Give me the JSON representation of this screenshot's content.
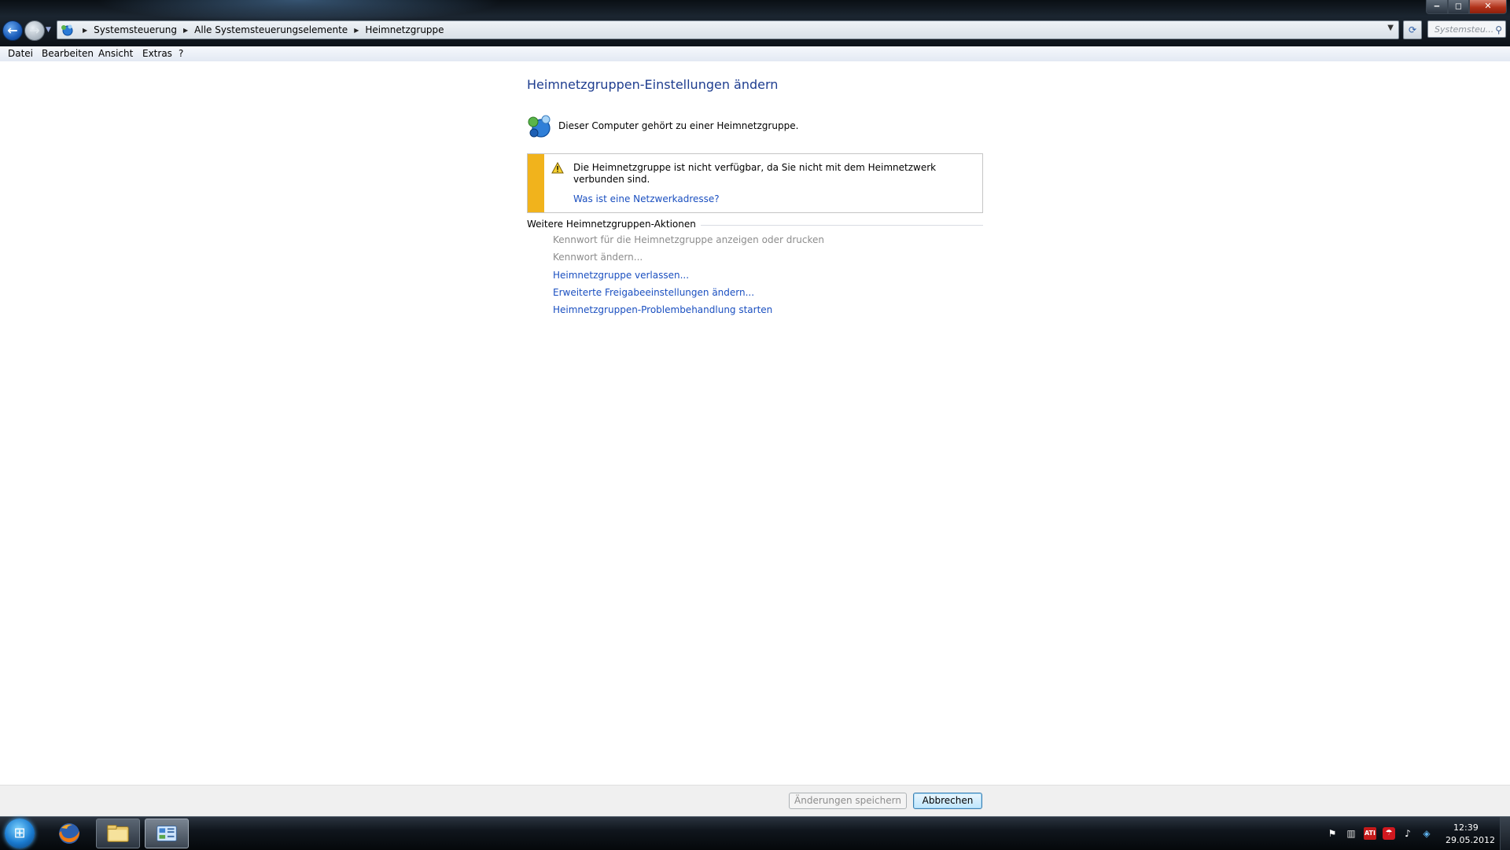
{
  "window": {
    "breadcrumb": [
      "Systemsteuerung",
      "Alle Systemsteuerungselemente",
      "Heimnetzgruppe"
    ],
    "search_placeholder": "Systemsteu...",
    "caption": {
      "minimize": "‒",
      "maximize": "◻",
      "close": "✕"
    }
  },
  "menu": [
    "Datei",
    "Bearbeiten",
    "Ansicht",
    "Extras",
    "?"
  ],
  "content": {
    "title": "Heimnetzgruppen-Einstellungen ändern",
    "status_text": "Dieser Computer gehört zu einer Heimnetzgruppe.",
    "warning": {
      "text": "Die Heimnetzgruppe ist nicht verfügbar, da Sie nicht mit dem Heimnetzwerk verbunden sind.",
      "link": "Was ist eine Netzwerkadresse?"
    },
    "section_header": "Weitere Heimnetzgruppen-Aktionen",
    "actions": [
      {
        "label": "Kennwort für die Heimnetzgruppe anzeigen oder drucken",
        "enabled": false
      },
      {
        "label": "Kennwort ändern...",
        "enabled": false
      },
      {
        "label": "Heimnetzgruppe verlassen...",
        "enabled": true
      },
      {
        "label": "Erweiterte Freigabeeinstellungen ändern...",
        "enabled": true
      },
      {
        "label": "Heimnetzgruppen-Problembehandlung starten",
        "enabled": true
      }
    ]
  },
  "buttons": {
    "save": "Änderungen speichern",
    "cancel": "Abbrechen"
  },
  "taskbar": {
    "items": [
      "firefox-icon",
      "windows-explorer-icon",
      "control-panel-icon"
    ],
    "tray_icons": [
      "action-center-flag-icon",
      "network-icon",
      "ati-catalyst-icon",
      "antivirus-icon",
      "volume-icon",
      "dropbox-icon"
    ],
    "tray_ati_label": "ATI",
    "clock_time": "12:39",
    "clock_date": "29.05.2012"
  },
  "colors": {
    "link": "#1a4fc0",
    "title": "#1e3d8f",
    "warning_bar": "#f1b31c",
    "disabled": "#8c8c8c"
  }
}
